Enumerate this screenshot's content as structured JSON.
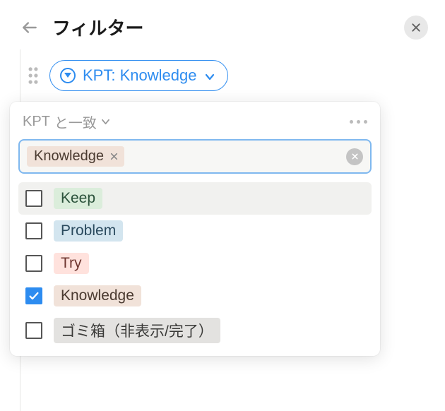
{
  "header": {
    "title": "フィルター"
  },
  "filter": {
    "chip_label": "KPT: Knowledge"
  },
  "panel": {
    "match_prefix": "KPT",
    "match_suffix": "と一致",
    "search_tag": "Knowledge",
    "options": [
      {
        "label": "Keep",
        "color": "green",
        "checked": false,
        "highlighted": true
      },
      {
        "label": "Problem",
        "color": "blue",
        "checked": false,
        "highlighted": false
      },
      {
        "label": "Try",
        "color": "red",
        "checked": false,
        "highlighted": false
      },
      {
        "label": "Knowledge",
        "color": "brown",
        "checked": true,
        "highlighted": false
      },
      {
        "label": "ゴミ箱（非表示/完了）",
        "color": "gray",
        "checked": false,
        "highlighted": false
      }
    ]
  }
}
